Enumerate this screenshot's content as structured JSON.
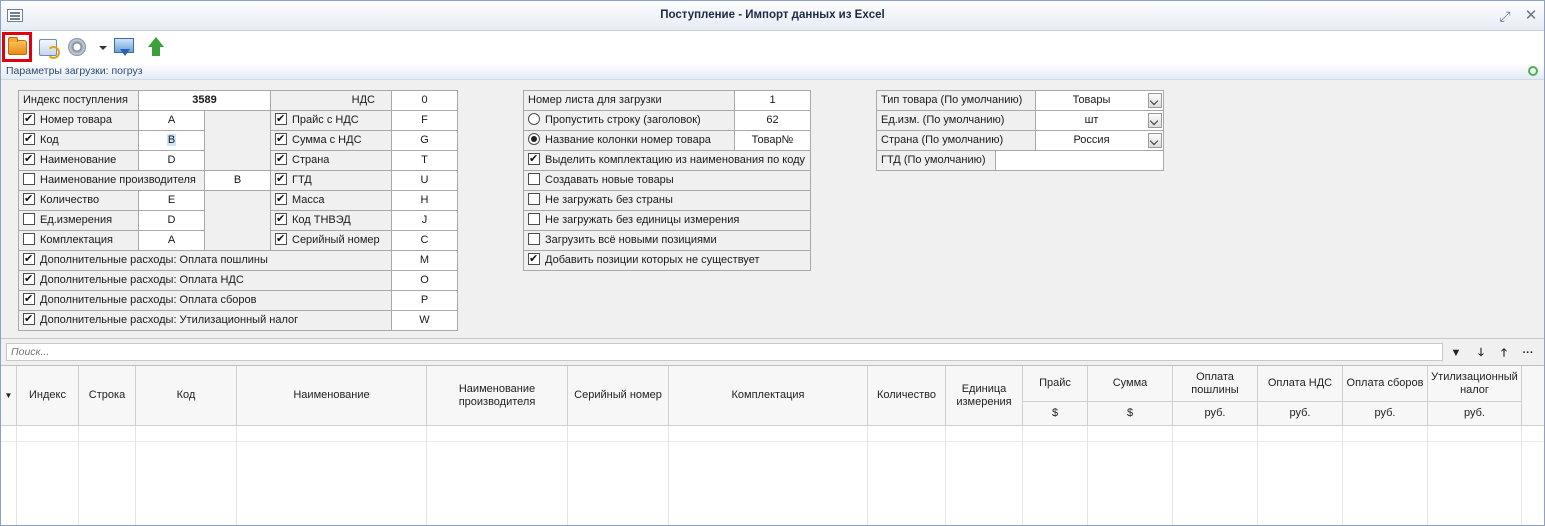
{
  "window": {
    "title": "Поступление - Импорт данных из Excel"
  },
  "params_bar": {
    "label": "Параметры загрузки: погруз"
  },
  "form1": {
    "receipt_index_label": "Индекс поступления",
    "receipt_index_value": "3589",
    "vat_label": "НДС",
    "vat_value": "0",
    "left_rows": [
      {
        "label": "Номер товара",
        "checked": true,
        "value": "A"
      },
      {
        "label": "Код",
        "checked": true,
        "value": "B"
      },
      {
        "label": "Наименование",
        "checked": true,
        "value": "D"
      },
      {
        "label": "Наименование производителя",
        "checked": false,
        "value": "B"
      },
      {
        "label": "Количество",
        "checked": true,
        "value": "E"
      },
      {
        "label": "Ед.измерения",
        "checked": false,
        "value": "D"
      },
      {
        "label": "Комплектация",
        "checked": false,
        "value": "A"
      }
    ],
    "right_rows": [
      {
        "label": "Прайс с НДС",
        "checked": true,
        "value": "F"
      },
      {
        "label": "Сумма с НДС",
        "checked": true,
        "value": "G"
      },
      {
        "label": "Страна",
        "checked": true,
        "value": "T"
      },
      {
        "label": "ГТД",
        "checked": true,
        "value": "U"
      },
      {
        "label": "Масса",
        "checked": true,
        "value": "H"
      },
      {
        "label": "Код ТНВЭД",
        "checked": true,
        "value": "J"
      },
      {
        "label": "Серийный номер",
        "checked": true,
        "value": "C"
      }
    ],
    "extra_rows": [
      {
        "label": "Дополнительные расходы: Оплата пошлины",
        "checked": true,
        "value": "M"
      },
      {
        "label": "Дополнительные расходы: Оплата НДС",
        "checked": true,
        "value": "O"
      },
      {
        "label": "Дополнительные расходы: Оплата сборов",
        "checked": true,
        "value": "P"
      },
      {
        "label": "Дополнительные расходы: Утилизационный налог",
        "checked": true,
        "value": "W"
      }
    ]
  },
  "form2": {
    "sheet_label": "Номер листа для загрузки",
    "sheet_value": "1",
    "skip_row_label": "Пропустить строку (заголовок)",
    "skip_row_value": "62",
    "col_name_label": "Название колонки номер товара",
    "col_name_value": "Товар№",
    "options": [
      {
        "label": "Выделить комплектацию из наименования по коду",
        "checked": true
      },
      {
        "label": "Создавать новые товары",
        "checked": false
      },
      {
        "label": "Не загружать без страны",
        "checked": false
      },
      {
        "label": "Не загружать без единицы измерения",
        "checked": false
      },
      {
        "label": "Загрузить всё новыми позициями",
        "checked": false
      },
      {
        "label": "Добавить позиции которых не существует",
        "checked": true
      }
    ]
  },
  "form3": {
    "rows": [
      {
        "label": "Тип товара (По умолчанию)",
        "value": "Товары",
        "dropdown": true
      },
      {
        "label": "Ед.изм. (По умолчанию)",
        "value": "шт",
        "dropdown": true
      },
      {
        "label": "Страна (По умолчанию)",
        "value": "Россия",
        "dropdown": true
      },
      {
        "label": "ГТД (По умолчанию)",
        "value": "",
        "dropdown": false
      }
    ]
  },
  "search": {
    "placeholder": "Поиск..."
  },
  "grid": {
    "columns": [
      {
        "label": "Индекс",
        "sub": ""
      },
      {
        "label": "Строка",
        "sub": ""
      },
      {
        "label": "Код",
        "sub": ""
      },
      {
        "label": "Наименование",
        "sub": ""
      },
      {
        "label": "Наименование производителя",
        "sub": ""
      },
      {
        "label": "Серийный номер",
        "sub": ""
      },
      {
        "label": "Комплектация",
        "sub": ""
      },
      {
        "label": "Количество",
        "sub": ""
      },
      {
        "label": "Единица измерения",
        "sub": ""
      },
      {
        "label": "Прайс",
        "sub": "$"
      },
      {
        "label": "Сумма",
        "sub": "$"
      },
      {
        "label": "Оплата пошлины",
        "sub": "руб."
      },
      {
        "label": "Оплата НДС",
        "sub": "руб."
      },
      {
        "label": "Оплата сборов",
        "sub": "руб."
      },
      {
        "label": "Утилизационный налог",
        "sub": "руб."
      }
    ]
  }
}
